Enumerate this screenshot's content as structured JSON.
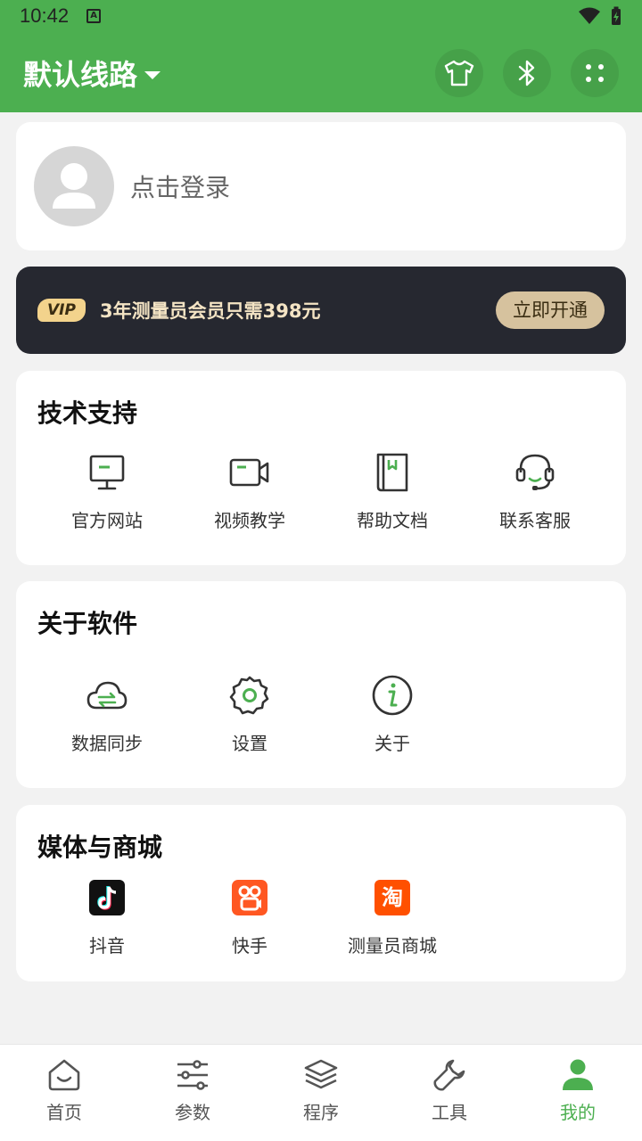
{
  "status_bar": {
    "time": "10:42",
    "notification_badge": "A"
  },
  "app_bar": {
    "title": "默认线路",
    "icons": [
      "tshirt-icon",
      "bluetooth-icon",
      "grid-dots-icon"
    ]
  },
  "login": {
    "prompt": "点击登录"
  },
  "vip": {
    "badge": "VIP",
    "text": "3年测量员会员只需398元",
    "button": "立即开通"
  },
  "support": {
    "title": "技术支持",
    "items": [
      {
        "label": "官方网站",
        "icon": "monitor-icon"
      },
      {
        "label": "视频教学",
        "icon": "video-camera-icon"
      },
      {
        "label": "帮助文档",
        "icon": "book-icon"
      },
      {
        "label": "联系客服",
        "icon": "headset-icon"
      }
    ]
  },
  "about": {
    "title": "关于软件",
    "items": [
      {
        "label": "数据同步",
        "icon": "cloud-sync-icon"
      },
      {
        "label": "设置",
        "icon": "gear-icon"
      },
      {
        "label": "关于",
        "icon": "info-icon"
      }
    ]
  },
  "media": {
    "title": "媒体与商城",
    "items": [
      {
        "label": "抖音",
        "icon": "douyin-icon"
      },
      {
        "label": "快手",
        "icon": "kuaishou-icon"
      },
      {
        "label": "测量员商城",
        "icon": "taobao-icon",
        "glyph": "淘"
      }
    ]
  },
  "nav": {
    "items": [
      {
        "label": "首页",
        "icon": "home-icon"
      },
      {
        "label": "参数",
        "icon": "sliders-icon"
      },
      {
        "label": "程序",
        "icon": "layers-icon"
      },
      {
        "label": "工具",
        "icon": "wrench-icon"
      },
      {
        "label": "我的",
        "icon": "user-icon",
        "active": true
      }
    ]
  },
  "colors": {
    "primary": "#4caf50",
    "vip_bg": "#262830",
    "vip_gold": "#d6c29e"
  }
}
